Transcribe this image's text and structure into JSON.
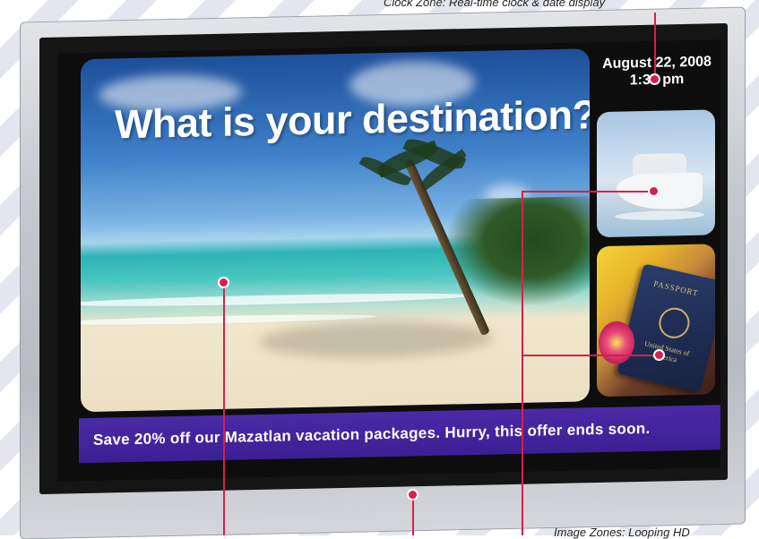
{
  "captions": {
    "clock_zone": "Clock Zone: Real-time clock & date display",
    "image_zones": "Image Zones: Looping HD"
  },
  "screen": {
    "headline": "What is your destination?",
    "clock": {
      "date": "August 22, 2008",
      "time": "1:37 pm"
    },
    "side_images": [
      {
        "icon": "cruise-ship-photo"
      },
      {
        "icon": "passport-photo",
        "passport_label": "PASSPORT",
        "country_label": "United States of America"
      }
    ],
    "ticker": "Save 20% off our Mazatlan vacation packages. Hurry, this offer ends soon."
  },
  "colors": {
    "callout": "#d6204d",
    "ticker_bg": "#3c1f94",
    "bezel": "#c5c8ce"
  }
}
